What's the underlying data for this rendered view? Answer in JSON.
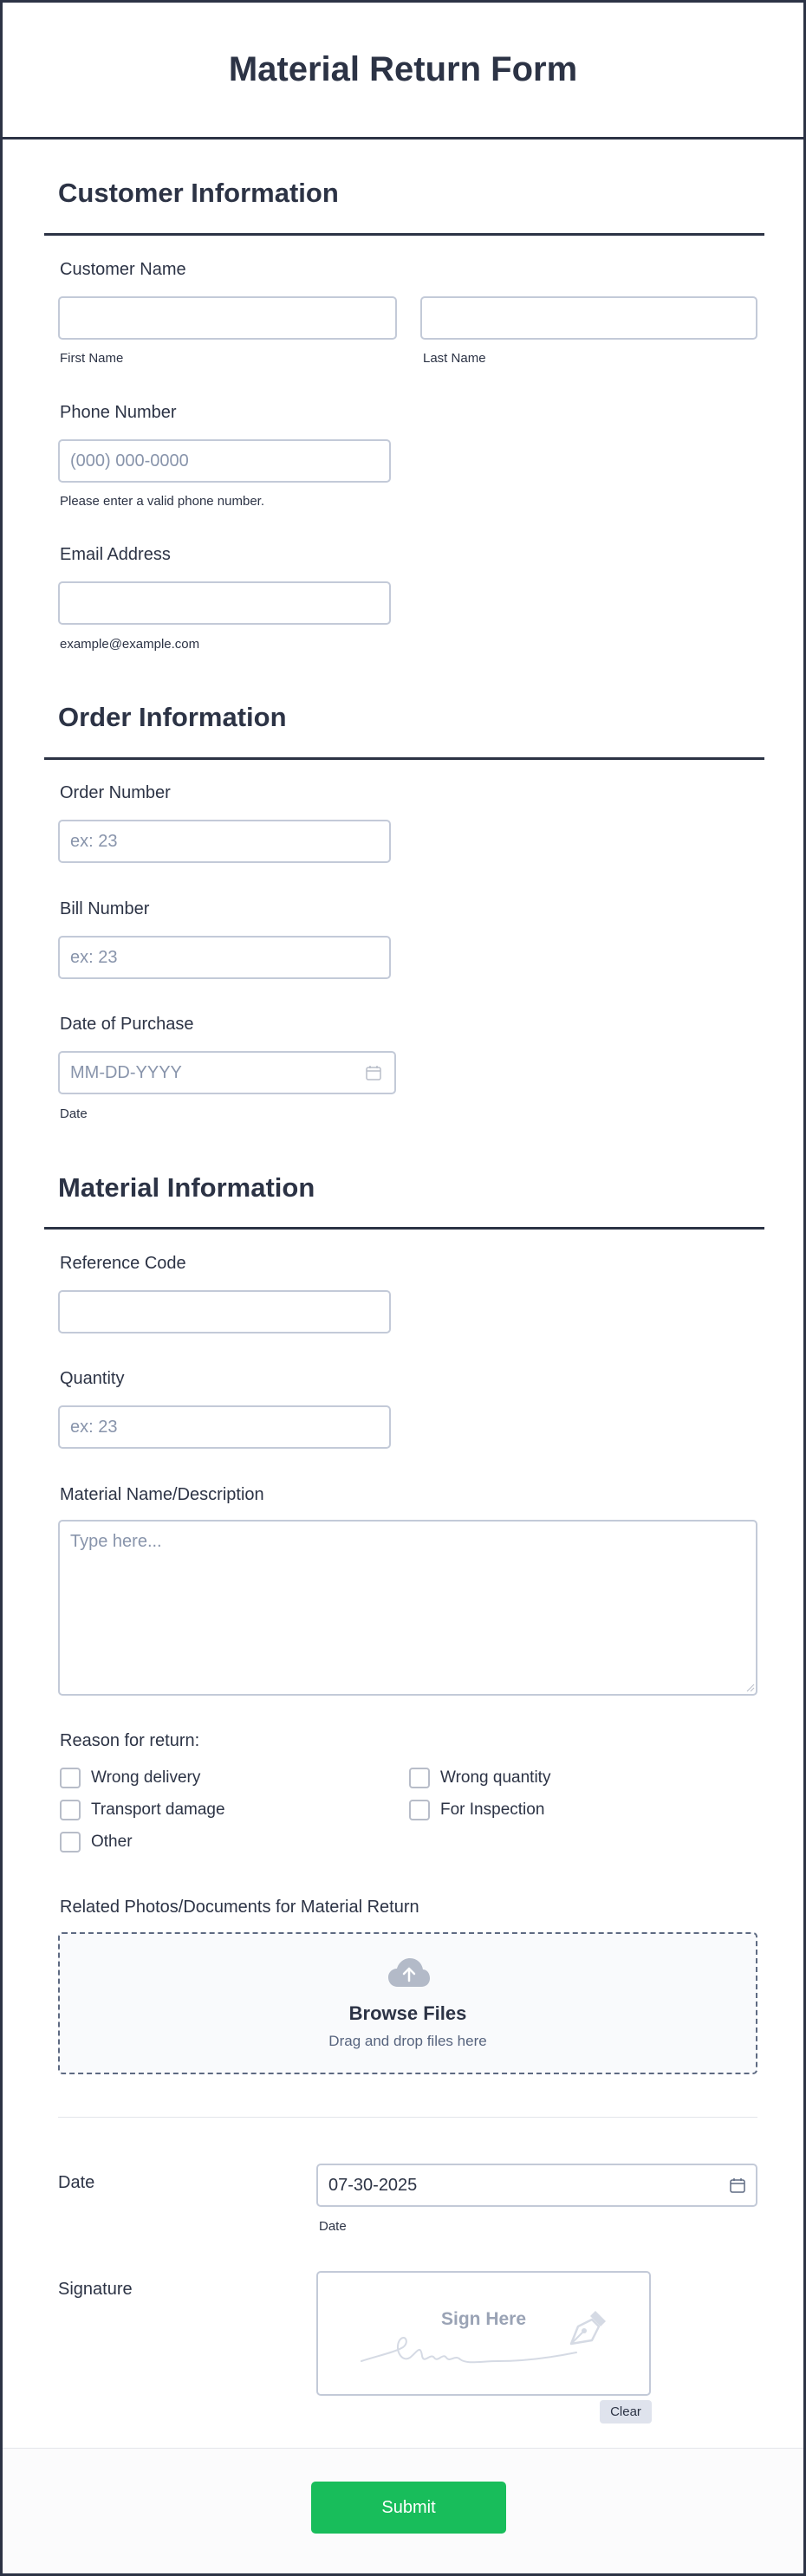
{
  "form": {
    "title": "Material Return Form"
  },
  "customer": {
    "section_title": "Customer Information",
    "name_label": "Customer Name",
    "first_name_sublabel": "First Name",
    "last_name_sublabel": "Last Name",
    "first_name_value": "",
    "last_name_value": "",
    "phone_label": "Phone Number",
    "phone_placeholder": "(000) 000-0000",
    "phone_hint": "Please enter a valid phone number.",
    "email_label": "Email Address",
    "email_value": "",
    "email_hint": "example@example.com"
  },
  "order": {
    "section_title": "Order Information",
    "order_number_label": "Order Number",
    "order_number_placeholder": "ex: 23",
    "bill_number_label": "Bill Number",
    "bill_number_placeholder": "ex: 23",
    "purchase_date_label": "Date of Purchase",
    "purchase_date_placeholder": "MM-DD-YYYY",
    "purchase_date_sublabel": "Date"
  },
  "material": {
    "section_title": "Material Information",
    "reference_code_label": "Reference Code",
    "reference_code_value": "",
    "quantity_label": "Quantity",
    "quantity_placeholder": "ex: 23",
    "description_label": "Material Name/Description",
    "description_placeholder": "Type here...",
    "reason_label": "Reason for return:",
    "reasons": [
      "Wrong delivery",
      "Wrong quantity",
      "Transport damage",
      "For Inspection",
      "Other"
    ]
  },
  "upload": {
    "label": "Related Photos/Documents for Material Return",
    "browse_title": "Browse Files",
    "browse_subtitle": "Drag and drop files here",
    "icon": "cloud-upload-icon"
  },
  "signoff": {
    "date_label": "Date",
    "date_value": "07-30-2025",
    "date_sublabel": "Date",
    "signature_label": "Signature",
    "sign_here_text": "Sign Here",
    "clear_label": "Clear"
  },
  "footer": {
    "submit_label": "Submit"
  },
  "colors": {
    "text": "#2c3345",
    "border": "#c3cad8",
    "placeholder": "#8894ab",
    "submit": "#18bd5b",
    "clear_button": "#dfe3ed"
  }
}
